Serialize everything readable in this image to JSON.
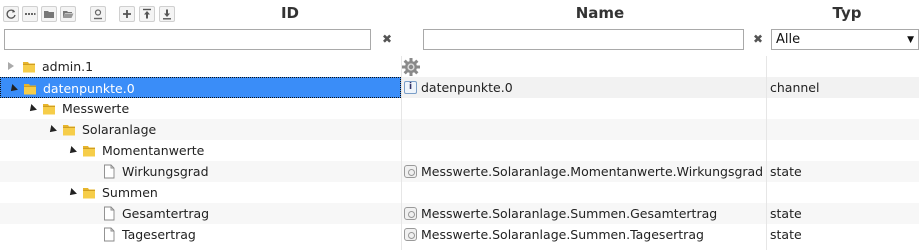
{
  "toolbar": {
    "buttons": [
      {
        "name": "refresh-icon"
      },
      {
        "name": "list-icon"
      },
      {
        "name": "folder-closed-icon"
      },
      {
        "name": "folder-open-icon"
      },
      {
        "name": "user-icon"
      },
      {
        "name": "add-icon"
      },
      {
        "name": "upload-icon"
      },
      {
        "name": "download-icon"
      }
    ]
  },
  "columns": {
    "id": "ID",
    "name": "Name",
    "type": "Typ"
  },
  "filters": {
    "id_value": "",
    "name_value": "",
    "clear_symbol": "✖",
    "type_selected": "Alle"
  },
  "rows": [
    {
      "label": "admin.1",
      "kind": "folder",
      "level": 0,
      "expanded": false,
      "name": "",
      "type": "",
      "gear": true
    },
    {
      "label": "datenpunkte.0",
      "kind": "folder",
      "level": 0,
      "expanded": true,
      "name": "datenpunkte.0",
      "type": "channel",
      "selected": true,
      "name_icon": "channel-icon"
    },
    {
      "label": "Messwerte",
      "kind": "folder",
      "level": 1,
      "expanded": true,
      "name": "",
      "type": ""
    },
    {
      "label": "Solaranlage",
      "kind": "folder",
      "level": 2,
      "expanded": true,
      "name": "",
      "type": ""
    },
    {
      "label": "Momentanwerte",
      "kind": "folder",
      "level": 3,
      "expanded": true,
      "name": "",
      "type": ""
    },
    {
      "label": "Wirkungsgrad",
      "kind": "file",
      "level": 4,
      "name": "Messwerte.Solaranlage.Momentanwerte.Wirkungsgrad",
      "type": "state",
      "name_icon": "state-icon"
    },
    {
      "label": "Summen",
      "kind": "folder",
      "level": 3,
      "expanded": true,
      "name": "",
      "type": ""
    },
    {
      "label": "Gesamtertrag",
      "kind": "file",
      "level": 4,
      "name": "Messwerte.Solaranlage.Summen.Gesamtertrag",
      "type": "state",
      "name_icon": "state-icon"
    },
    {
      "label": "Tagesertrag",
      "kind": "file",
      "level": 4,
      "name": "Messwerte.Solaranlage.Summen.Tagesertrag",
      "type": "state",
      "name_icon": "state-icon"
    }
  ],
  "colors": {
    "selected": "#3a8df8",
    "folder": "#f0c23b"
  }
}
